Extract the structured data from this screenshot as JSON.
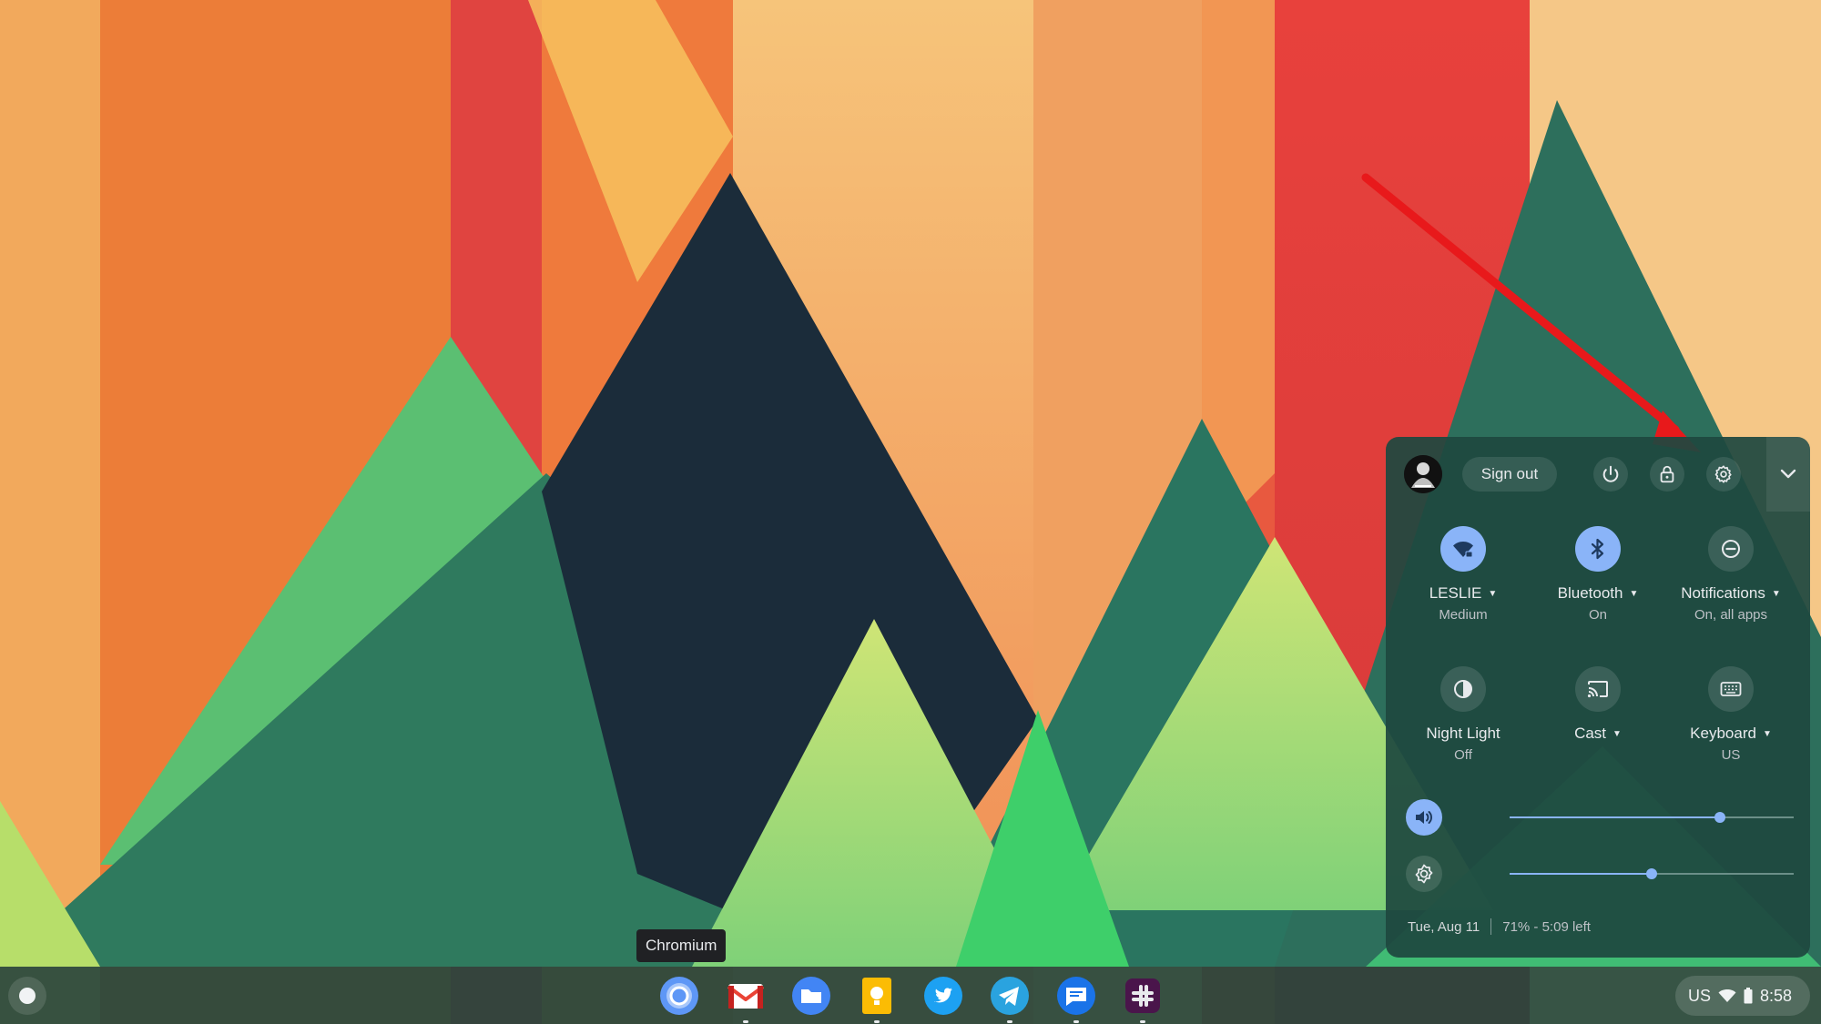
{
  "tooltip": {
    "text": "Chromium"
  },
  "shelf": {
    "apps": [
      {
        "name": "chromium-icon",
        "running": false
      },
      {
        "name": "gmail-icon",
        "running": true
      },
      {
        "name": "files-icon",
        "running": false
      },
      {
        "name": "keep-icon",
        "running": true
      },
      {
        "name": "twitter-icon",
        "running": false
      },
      {
        "name": "telegram-icon",
        "running": true
      },
      {
        "name": "messages-icon",
        "running": true
      },
      {
        "name": "slack-icon",
        "running": true
      }
    ],
    "status": {
      "ime": "US",
      "time": "8:58"
    }
  },
  "quick_settings": {
    "sign_out_label": "Sign out",
    "tiles": {
      "network": {
        "label": "LESLIE",
        "sub": "Medium"
      },
      "bluetooth": {
        "label": "Bluetooth",
        "sub": "On"
      },
      "notifications": {
        "label": "Notifications",
        "sub": "On, all apps"
      },
      "night_light": {
        "label": "Night Light",
        "sub": "Off"
      },
      "cast": {
        "label": "Cast",
        "sub": ""
      },
      "keyboard": {
        "label": "Keyboard",
        "sub": "US"
      }
    },
    "volume_level": 0.74,
    "brightness_level": 0.5,
    "date": "Tue, Aug 11",
    "battery": "71% - 5:09 left"
  },
  "colors": {
    "accent": "#8ab4f8",
    "panel": "#1e4840",
    "annotation_arrow": "#e8191b"
  }
}
